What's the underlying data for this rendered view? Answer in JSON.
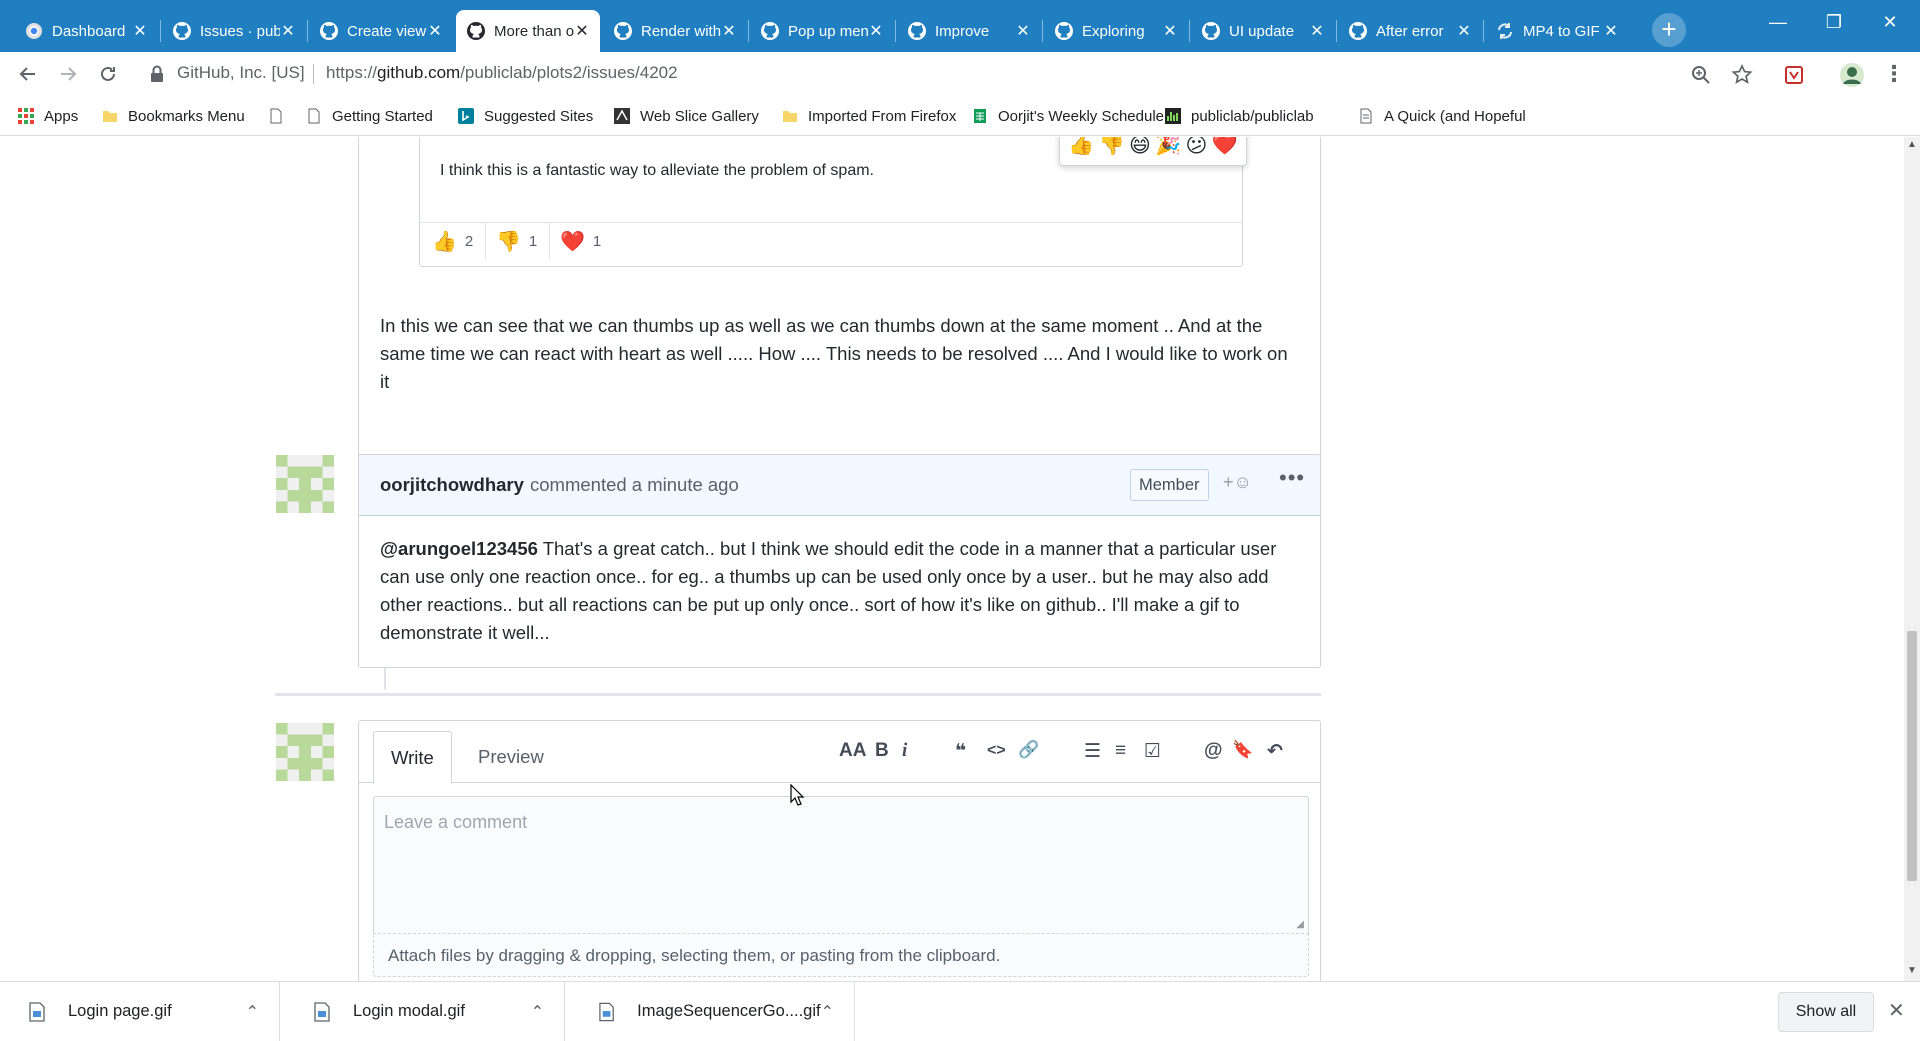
{
  "browser": {
    "tabs": [
      {
        "title": "Dashboard",
        "icon": "chrome-icon"
      },
      {
        "title": "Issues · publiclab",
        "icon": "github-icon"
      },
      {
        "title": "Create view",
        "icon": "github-icon"
      },
      {
        "title": "More than one reaction",
        "icon": "github-icon",
        "active": true
      },
      {
        "title": "Render with",
        "icon": "github-icon"
      },
      {
        "title": "Pop up menu",
        "icon": "github-icon"
      },
      {
        "title": "Improve",
        "icon": "github-icon"
      },
      {
        "title": "Exploring",
        "icon": "github-icon"
      },
      {
        "title": "UI update",
        "icon": "github-icon"
      },
      {
        "title": "After error",
        "icon": "github-icon"
      },
      {
        "title": "MP4 to GIF",
        "icon": "convert-icon"
      }
    ],
    "tab_close": "✕",
    "new_tab": "+",
    "window_controls": {
      "minimize": "—",
      "restore": "❐",
      "close": "✕"
    },
    "address": {
      "site_identity": "GitHub, Inc. [US]",
      "url_prefix": "https://",
      "url_host": "github.com",
      "url_path": "/publiclab/plots2/issues/4202"
    },
    "bookmarks": [
      {
        "label": "Apps",
        "icon": "apps-grid-icon"
      },
      {
        "label": "Bookmarks Menu",
        "icon": "folder-icon"
      },
      {
        "label": "",
        "icon": "page-icon"
      },
      {
        "label": "Getting Started",
        "icon": "page-icon"
      },
      {
        "label": "Suggested Sites",
        "icon": "bing-icon"
      },
      {
        "label": "Web Slice Gallery",
        "icon": "web-slice-icon"
      },
      {
        "label": "Imported From Firefox",
        "icon": "folder-icon"
      },
      {
        "label": "Oorjit's Weekly Schedule",
        "icon": "sheets-icon"
      },
      {
        "label": "publiclab/publiclab",
        "icon": "chart-icon"
      },
      {
        "label": "A Quick (and Hopeful",
        "icon": "doc-icon"
      }
    ]
  },
  "issue": {
    "quoted_text": "I think this is a fantastic way to alleviate the problem of spam.",
    "reaction_picker": [
      "👍",
      "👎",
      "😄",
      "🎉",
      "😕",
      "❤️"
    ],
    "quoted_reactions": [
      {
        "emoji": "👍",
        "count": "2"
      },
      {
        "emoji": "👎",
        "count": "1"
      },
      {
        "emoji": "❤️",
        "count": "1"
      }
    ],
    "first_comment_text": "In this we can see that we can thumbs up as well as we can thumbs down at the same moment .. And at the same time we can react with heart as well ..... How .... This needs to be resolved .... And I would like to work on it",
    "second_comment": {
      "author": "oorjitchowdhary",
      "meta": "commented a minute ago",
      "badge": "Member",
      "add_reaction": "+☺",
      "more": "•••",
      "mention": "@arungoel123456",
      "text": " That's a great catch.. but I think we should edit the code in a manner that a particular user can use only one reaction once.. for eg.. a thumbs up can be used only once by a user.. but he may also add other reactions.. but all reactions can be put up only once.. sort of how it's like on github.. I'll make a gif to demonstrate it well..."
    },
    "editor": {
      "tab_write": "Write",
      "tab_preview": "Preview",
      "tools": [
        "AA",
        "B",
        "i",
        "❝",
        "<>",
        "🔗",
        "☰",
        "≡",
        "☑",
        "@",
        "🔖",
        "↶"
      ],
      "placeholder": "Leave a comment",
      "attach_text": "Attach files by dragging & dropping, selecting them, or pasting from the clipboard."
    }
  },
  "downloads": {
    "items": [
      {
        "name": "Login page.gif"
      },
      {
        "name": "Login modal.gif"
      },
      {
        "name": "ImageSequencerGo....gif"
      }
    ],
    "show_all": "Show all",
    "close": "✕"
  },
  "colors": {
    "tabstrip": "#1f7fc1",
    "comment_header": "#f1f8ff",
    "avatar_green": "#b8d99a"
  }
}
